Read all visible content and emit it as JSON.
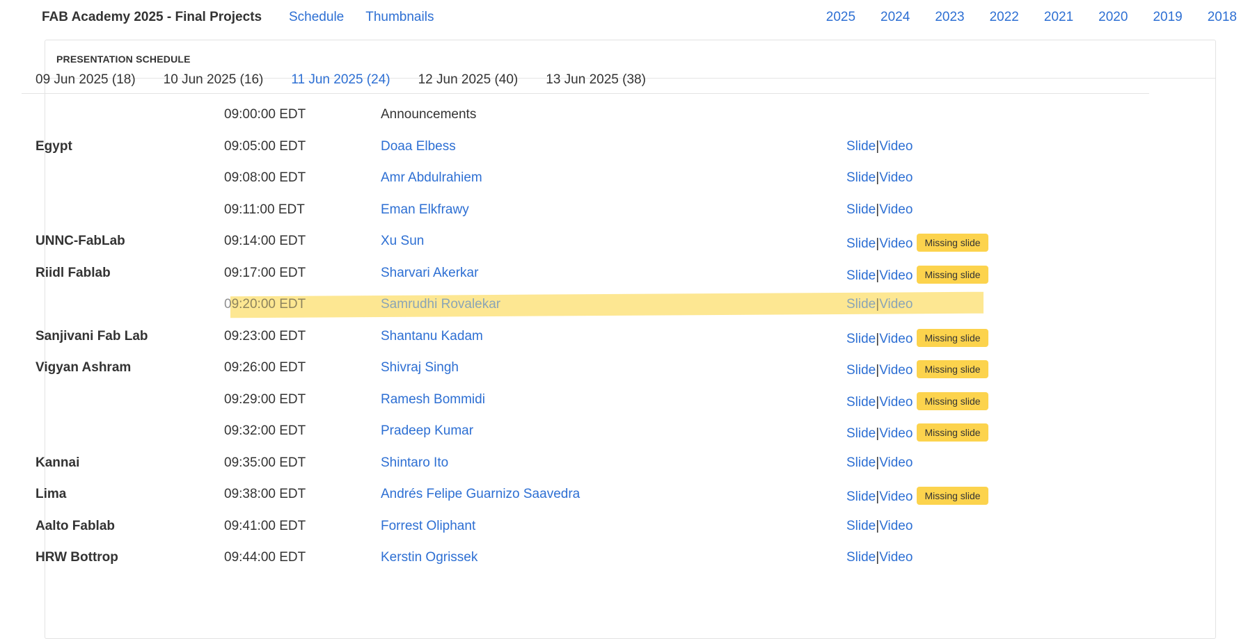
{
  "header": {
    "brand": "FAB Academy 2025 - Final Projects",
    "nav": [
      "Schedule",
      "Thumbnails"
    ],
    "years": [
      "2025",
      "2024",
      "2023",
      "2022",
      "2021",
      "2020",
      "2019",
      "2018"
    ]
  },
  "panel": {
    "title": "PRESENTATION SCHEDULE"
  },
  "tabs": [
    {
      "label": "09 Jun 2025 (18)",
      "active": false
    },
    {
      "label": "10 Jun 2025 (16)",
      "active": false
    },
    {
      "label": "11 Jun 2025 (24)",
      "active": true
    },
    {
      "label": "12 Jun 2025 (40)",
      "active": false
    },
    {
      "label": "13 Jun 2025 (38)",
      "active": false
    }
  ],
  "link_labels": {
    "slide": "Slide",
    "separator": "|",
    "video": "Video"
  },
  "badge_label": "Missing slide",
  "rows": [
    {
      "lab": "",
      "time": "09:00:00 EDT",
      "name": "Announcements",
      "is_link": false,
      "links": false,
      "missing": false,
      "highlight": false
    },
    {
      "lab": "Egypt",
      "time": "09:05:00 EDT",
      "name": "Doaa Elbess",
      "is_link": true,
      "links": true,
      "missing": false,
      "highlight": false
    },
    {
      "lab": "",
      "time": "09:08:00 EDT",
      "name": "Amr Abdulrahiem",
      "is_link": true,
      "links": true,
      "missing": false,
      "highlight": false
    },
    {
      "lab": "",
      "time": "09:11:00 EDT",
      "name": "Eman Elkfrawy",
      "is_link": true,
      "links": true,
      "missing": false,
      "highlight": false
    },
    {
      "lab": "UNNC-FabLab",
      "time": "09:14:00 EDT",
      "name": "Xu Sun",
      "is_link": true,
      "links": true,
      "missing": true,
      "highlight": false
    },
    {
      "lab": "Riidl Fablab",
      "time": "09:17:00 EDT",
      "name": "Sharvari Akerkar",
      "is_link": true,
      "links": true,
      "missing": true,
      "highlight": false
    },
    {
      "lab": "",
      "time": "09:20:00 EDT",
      "name": "Samrudhi Rovalekar",
      "is_link": true,
      "links": true,
      "missing": false,
      "highlight": true
    },
    {
      "lab": "Sanjivani Fab Lab",
      "time": "09:23:00 EDT",
      "name": "Shantanu Kadam",
      "is_link": true,
      "links": true,
      "missing": true,
      "highlight": false
    },
    {
      "lab": "Vigyan Ashram",
      "time": "09:26:00 EDT",
      "name": "Shivraj Singh",
      "is_link": true,
      "links": true,
      "missing": true,
      "highlight": false
    },
    {
      "lab": "",
      "time": "09:29:00 EDT",
      "name": "Ramesh Bommidi",
      "is_link": true,
      "links": true,
      "missing": true,
      "highlight": false
    },
    {
      "lab": "",
      "time": "09:32:00 EDT",
      "name": "Pradeep Kumar",
      "is_link": true,
      "links": true,
      "missing": true,
      "highlight": false
    },
    {
      "lab": "Kannai",
      "time": "09:35:00 EDT",
      "name": "Shintaro Ito",
      "is_link": true,
      "links": true,
      "missing": false,
      "highlight": false
    },
    {
      "lab": "Lima",
      "time": "09:38:00 EDT",
      "name": "Andrés Felipe Guarnizo Saavedra",
      "is_link": true,
      "links": true,
      "missing": true,
      "highlight": false
    },
    {
      "lab": "Aalto Fablab",
      "time": "09:41:00 EDT",
      "name": "Forrest Oliphant",
      "is_link": true,
      "links": true,
      "missing": false,
      "highlight": false
    },
    {
      "lab": "HRW Bottrop",
      "time": "09:44:00 EDT",
      "name": "Kerstin Ogrissek",
      "is_link": true,
      "links": true,
      "missing": false,
      "highlight": false
    }
  ],
  "colors": {
    "link": "#2d6fd3",
    "badge": "#fcd34d",
    "highlight": "#fde68c",
    "text": "#333333"
  }
}
